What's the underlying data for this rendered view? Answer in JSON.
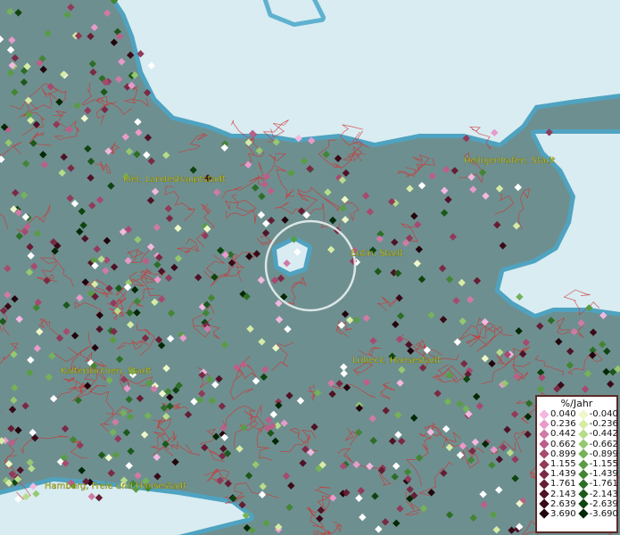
{
  "map": {
    "colors": {
      "sea": "#d8ecf2",
      "land": "#6e8f8f",
      "coast_halo": "#4aa7c9",
      "borders": "#d43030",
      "focus_ring": "#e8f0f0"
    },
    "labels": [
      {
        "id": "kiel",
        "text": "Kiel, Landeshauptstadt"
      },
      {
        "id": "heiligenhafen",
        "text": "Heiligenhafen, Stadt"
      },
      {
        "id": "eutin",
        "text": "Eutin, Stadt"
      },
      {
        "id": "luebeck",
        "text": "Lübeck, Hansestadt"
      },
      {
        "id": "kaltenkirchen",
        "text": "Kaltenkirchen, Stadt"
      },
      {
        "id": "hamburg",
        "text": "Hamburg, Freie und Hansestadt"
      }
    ]
  },
  "legend": {
    "title": "%/Jahr",
    "positive": [
      {
        "value": "0.040",
        "color": "#f2b8e0"
      },
      {
        "value": "0.236",
        "color": "#e89acb"
      },
      {
        "value": "0.442",
        "color": "#d07aa6"
      },
      {
        "value": "0.662",
        "color": "#bb5f8a"
      },
      {
        "value": "0.899",
        "color": "#a64a70"
      },
      {
        "value": "1.155",
        "color": "#913a5a"
      },
      {
        "value": "1.439",
        "color": "#7a2a45"
      },
      {
        "value": "1.761",
        "color": "#651d34"
      },
      {
        "value": "2.143",
        "color": "#4f1226"
      },
      {
        "value": "2.639",
        "color": "#3a0a18"
      },
      {
        "value": "3.690",
        "color": "#22050c"
      }
    ],
    "negative": [
      {
        "value": "-0.040",
        "color": "#eef7c8"
      },
      {
        "value": "-0.236",
        "color": "#d6eca5"
      },
      {
        "value": "-0.442",
        "color": "#b7dc8a"
      },
      {
        "value": "-0.662",
        "color": "#95c870"
      },
      {
        "value": "-0.899",
        "color": "#75b25a"
      },
      {
        "value": "-1.155",
        "color": "#5a9c45"
      },
      {
        "value": "-1.439",
        "color": "#428535"
      },
      {
        "value": "-1.761",
        "color": "#2d6e27"
      },
      {
        "value": "-2.143",
        "color": "#1d581b"
      },
      {
        "value": "-2.639",
        "color": "#0f4410"
      },
      {
        "value": "-3.690",
        "color": "#042806"
      }
    ]
  }
}
